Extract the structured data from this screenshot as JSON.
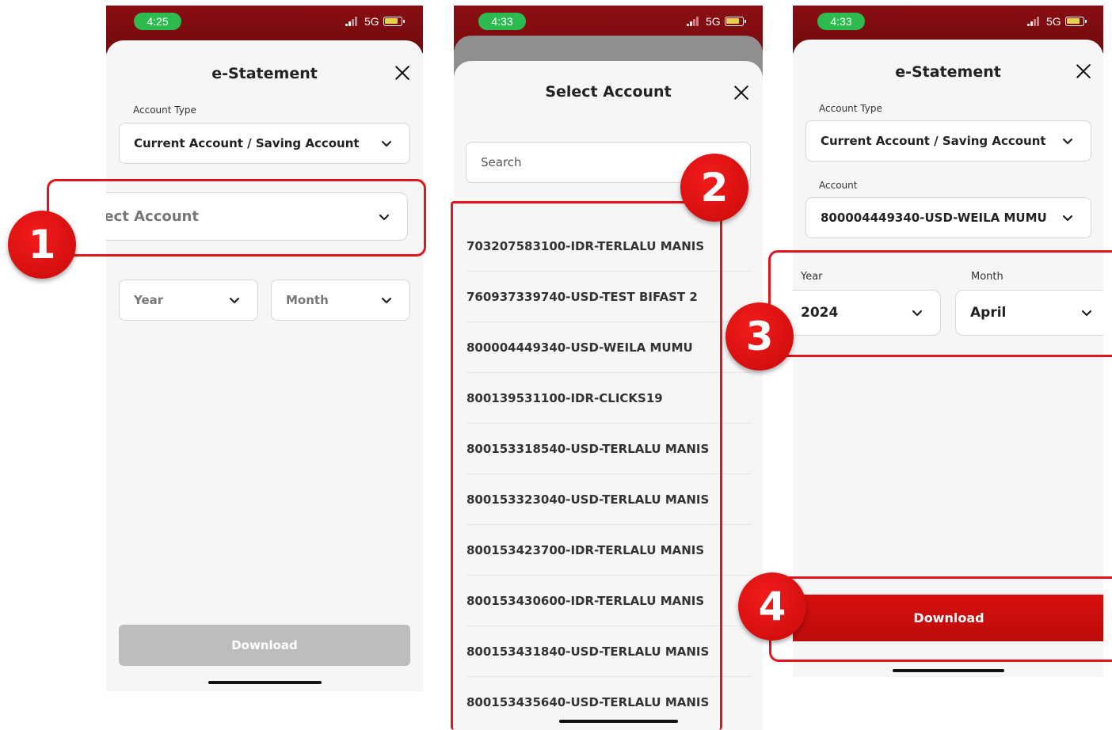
{
  "screens": [
    {
      "time": "4:25",
      "network": "5G",
      "title": "e-Statement",
      "account_type_label": "Account Type",
      "account_type_value": "Current Account / Saving Account",
      "account_placeholder": "Select Account",
      "year_placeholder": "Year",
      "month_placeholder": "Month",
      "download_label": "Download",
      "download_enabled": false
    },
    {
      "time": "4:33",
      "network": "5G",
      "title": "Select Account",
      "search_placeholder": "Search",
      "accounts": [
        "703207583100-IDR-TERLALU MANIS",
        "760937339740-USD-TEST BIFAST 2",
        "800004449340-USD-WEILA MUMU",
        "800139531100-IDR-CLICKS19",
        "800153318540-USD-TERLALU MANIS",
        "800153323040-USD-TERLALU MANIS",
        "800153423700-IDR-TERLALU MANIS",
        "800153430600-IDR-TERLALU MANIS",
        "800153431840-USD-TERLALU MANIS",
        "800153435640-USD-TERLALU MANIS"
      ]
    },
    {
      "time": "4:33",
      "network": "5G",
      "title": "e-Statement",
      "account_type_label": "Account Type",
      "account_type_value": "Current Account / Saving Account",
      "account_label": "Account",
      "account_value": "800004449340-USD-WEILA MUMU",
      "year_label": "Year",
      "year_value": "2024",
      "month_label": "Month",
      "month_value": "April",
      "download_label": "Download",
      "download_enabled": true
    }
  ],
  "steps": [
    "1",
    "2",
    "3",
    "4"
  ],
  "colors": {
    "brand_red": "#d10c10",
    "header_dark_red": "#7a0b0e",
    "highlight": "#e3141b",
    "disabled_button": "#bdbdbd",
    "time_pill": "#2dbb4f"
  }
}
